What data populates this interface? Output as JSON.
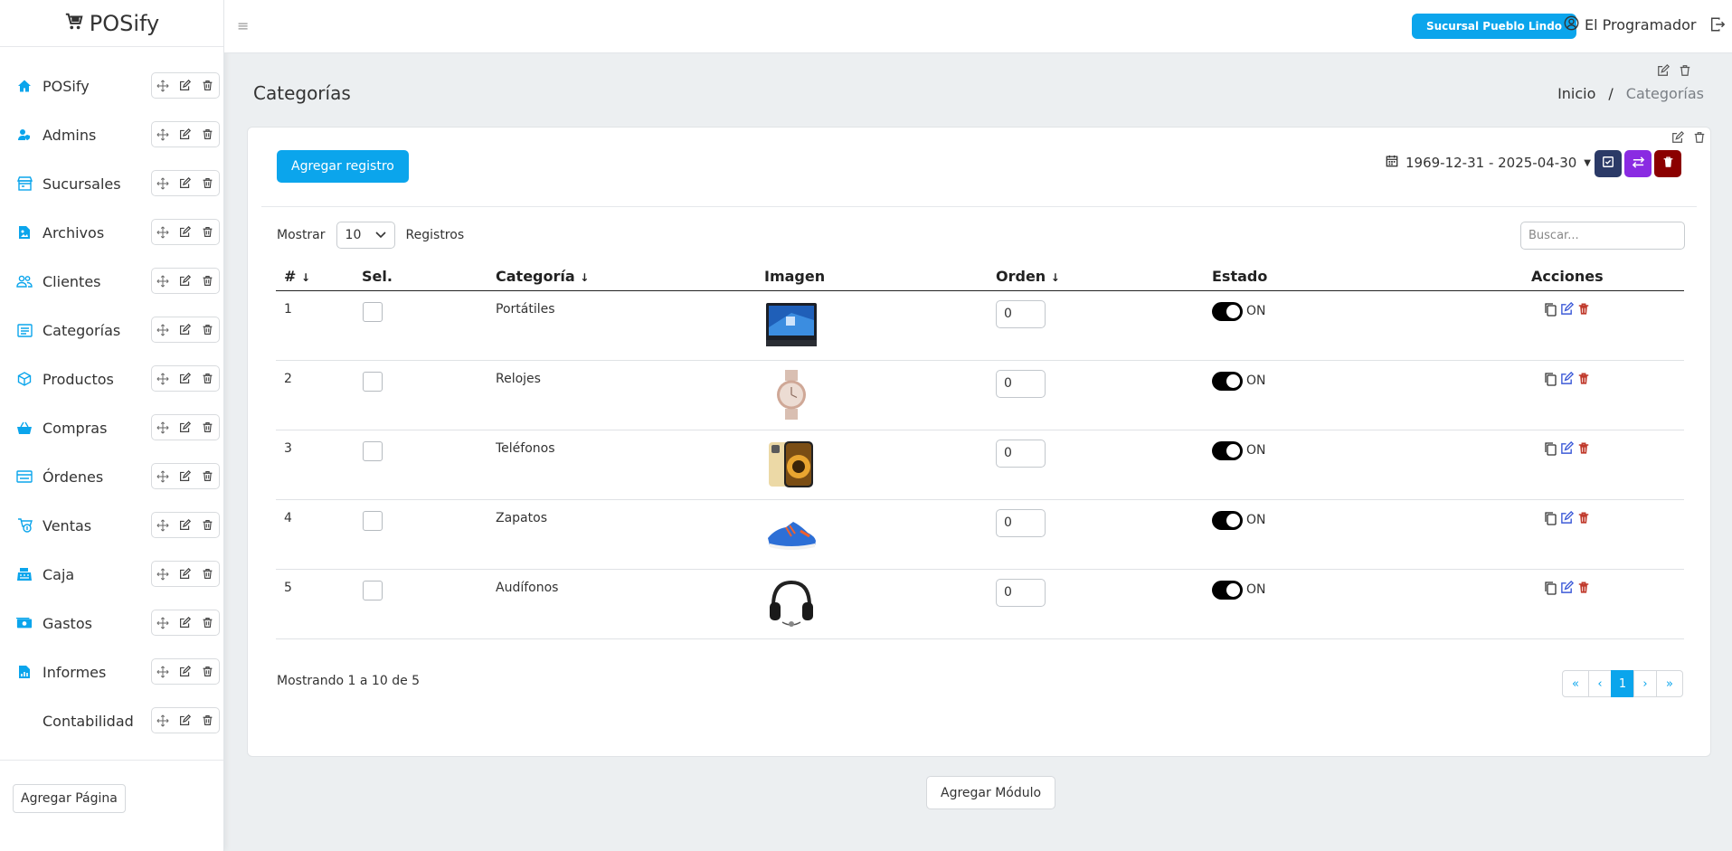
{
  "brand": {
    "name": "POSify"
  },
  "sidebar": {
    "items": [
      {
        "label": "POSify",
        "icon": "home-icon"
      },
      {
        "label": "Admins",
        "icon": "user-shield-icon"
      },
      {
        "label": "Sucursales",
        "icon": "store-icon"
      },
      {
        "label": "Archivos",
        "icon": "file-image-icon"
      },
      {
        "label": "Clientes",
        "icon": "users-icon"
      },
      {
        "label": "Categorías",
        "icon": "list-icon"
      },
      {
        "label": "Productos",
        "icon": "box-icon"
      },
      {
        "label": "Compras",
        "icon": "basket-icon"
      },
      {
        "label": "Órdenes",
        "icon": "ticket-icon"
      },
      {
        "label": "Ventas",
        "icon": "sales-icon"
      },
      {
        "label": "Caja",
        "icon": "cash-register-icon"
      },
      {
        "label": "Gastos",
        "icon": "money-icon"
      },
      {
        "label": "Informes",
        "icon": "chart-file-icon"
      },
      {
        "label": "Contabilidad",
        "icon": ""
      }
    ],
    "add_page": "Agregar Página"
  },
  "topbar": {
    "branch": "Sucursal Pueblo Lindo",
    "user": "El Programador"
  },
  "page": {
    "title": "Categorías",
    "breadcrumb": {
      "home": "Inicio",
      "sep": "/",
      "current": "Categorías"
    }
  },
  "card": {
    "add_record": "Agregar registro",
    "date_range": "1969-12-31 - 2025-04-30",
    "length": {
      "prefix": "Mostrar",
      "value": "10",
      "suffix": "Registros"
    },
    "search_placeholder": "Buscar...",
    "columns": [
      "#",
      "Sel.",
      "Categoría",
      "Imagen",
      "Orden",
      "Estado",
      "Acciones"
    ],
    "rows": [
      {
        "num": "1",
        "category": "Portátiles",
        "image": "laptop",
        "order": "0",
        "state": "ON"
      },
      {
        "num": "2",
        "category": "Relojes",
        "image": "watch",
        "order": "0",
        "state": "ON"
      },
      {
        "num": "3",
        "category": "Teléfonos",
        "image": "phone",
        "order": "0",
        "state": "ON"
      },
      {
        "num": "4",
        "category": "Zapatos",
        "image": "shoe",
        "order": "0",
        "state": "ON"
      },
      {
        "num": "5",
        "category": "Audífonos",
        "image": "headphones",
        "order": "0",
        "state": "ON"
      }
    ],
    "info": "Mostrando 1 a 10 de 5",
    "pager": {
      "first": "«",
      "prev": "‹",
      "current": "1",
      "next": "›",
      "last": "»"
    }
  },
  "add_module": "Agregar Módulo",
  "colors": {
    "accent": "#0ba5ec",
    "navy": "#2b3a67",
    "purple": "#8a2be2",
    "darkred": "#8b0000"
  }
}
